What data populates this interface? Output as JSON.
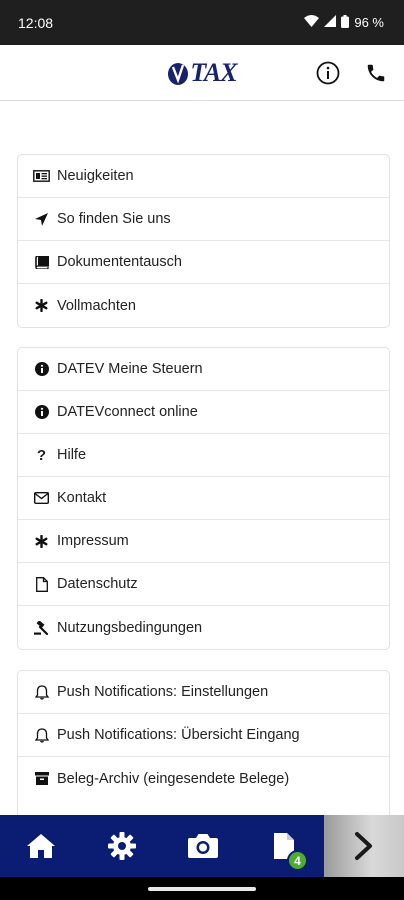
{
  "status_bar": {
    "time": "12:08",
    "battery": "96 %"
  },
  "header": {
    "logo_text": "TAX",
    "logo_letter": "V",
    "icons": [
      "info-icon",
      "phone-icon"
    ]
  },
  "menu_group_1": [
    {
      "label": "Neuigkeiten",
      "icon": "newspaper-icon"
    },
    {
      "label": "So finden Sie uns",
      "icon": "location-arrow-icon"
    },
    {
      "label": "Dokumententausch",
      "icon": "book-icon"
    },
    {
      "label": "Vollmachten",
      "icon": "asterisk-icon"
    }
  ],
  "menu_group_2": [
    {
      "label": "DATEV Meine Steuern",
      "icon": "info-circle-icon"
    },
    {
      "label": "DATEVconnect online",
      "icon": "info-circle-icon"
    },
    {
      "label": "Hilfe",
      "icon": "question-icon"
    },
    {
      "label": "Kontakt",
      "icon": "envelope-icon"
    },
    {
      "label": "Impressum",
      "icon": "asterisk-icon"
    },
    {
      "label": "Datenschutz",
      "icon": "file-icon"
    },
    {
      "label": "Nutzungsbedingungen",
      "icon": "gavel-icon"
    }
  ],
  "menu_group_3": [
    {
      "label": "Push Notifications: Einstellungen",
      "icon": "bell-icon"
    },
    {
      "label": "Push Notifications: Übersicht Eingang",
      "icon": "bell-icon"
    },
    {
      "label": "Beleg-Archiv (eingesendete Belege)",
      "icon": "archive-icon"
    }
  ],
  "bottom_nav": {
    "items": [
      "home-icon",
      "gear-icon",
      "camera-icon",
      "document-icon",
      "chevron-right-icon"
    ],
    "badge_count": "4"
  },
  "colors": {
    "brand_navy": "#0b1c73",
    "badge_green": "#4cae2f"
  }
}
